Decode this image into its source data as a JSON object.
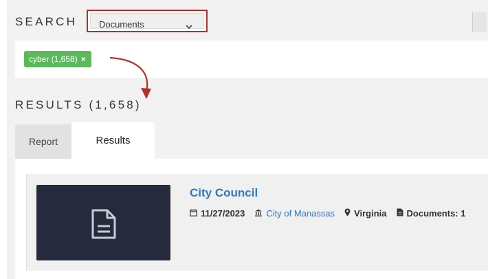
{
  "search": {
    "label": "SEARCH",
    "type_select": "Documents"
  },
  "filters": {
    "tags": [
      {
        "label": "cyber (1,658)",
        "remove": "×"
      }
    ]
  },
  "results": {
    "heading": "RESULTS (1,658)"
  },
  "tabs": [
    {
      "label": "Report",
      "active": false
    },
    {
      "label": "Results",
      "active": true
    }
  ],
  "items": [
    {
      "title": "City Council",
      "date": "11/27/2023",
      "organization": "City of Manassas",
      "location": "Virginia",
      "documents": "Documents: 1",
      "thumbnail_icon": "document-icon"
    }
  ],
  "colors": {
    "accent_red": "#b3302a",
    "tag_green": "#5cb85c",
    "link_blue": "#2f78c4",
    "thumb_bg": "#252b3d"
  }
}
